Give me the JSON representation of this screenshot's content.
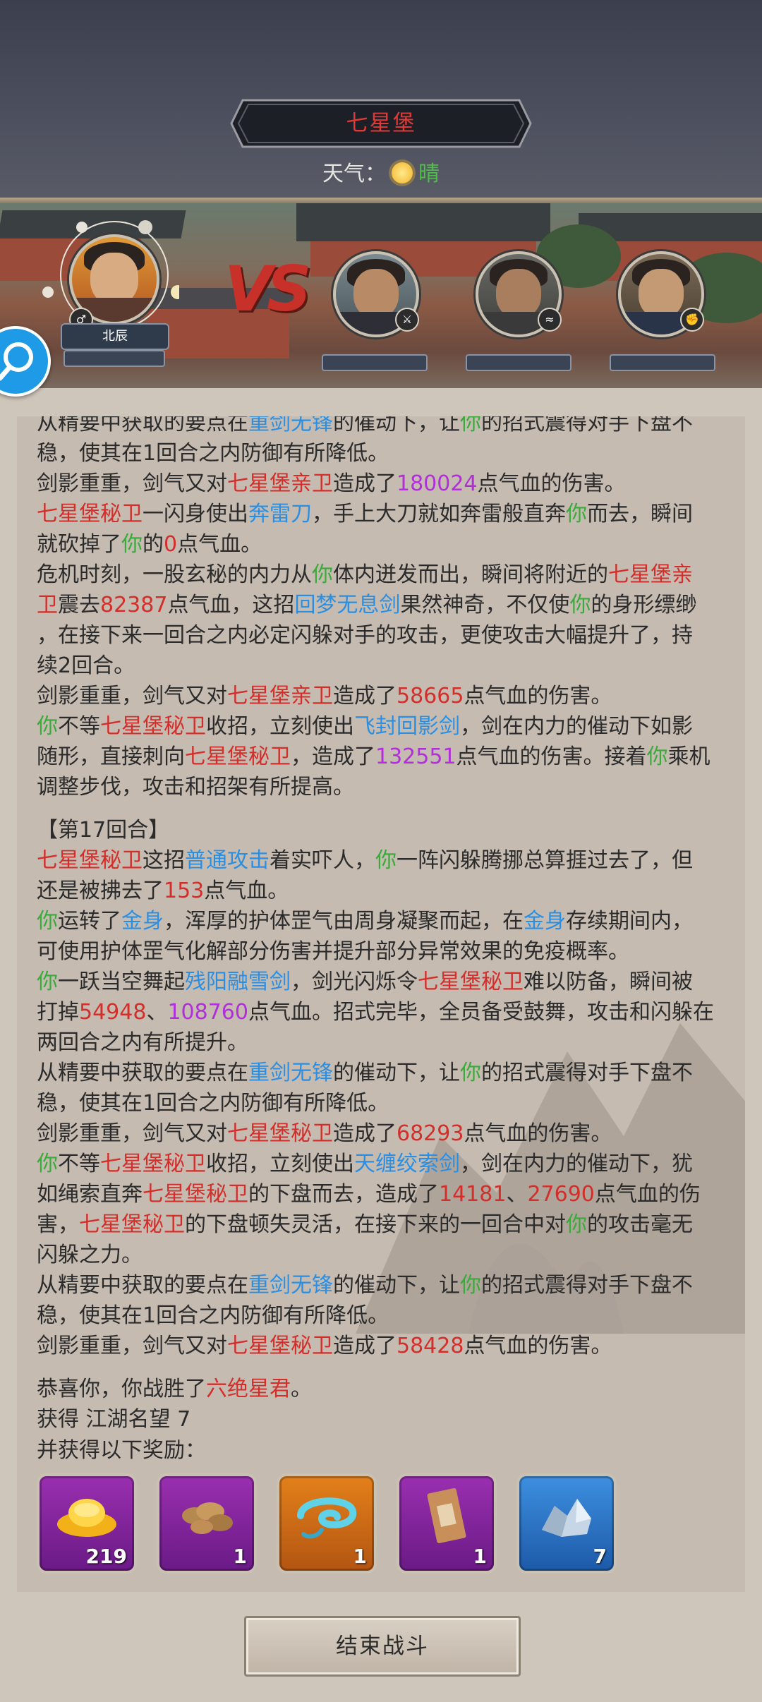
{
  "header": {
    "location": "七星堡",
    "weather_label": "天气：",
    "weather_condition": "晴"
  },
  "battle": {
    "player_name": "北辰",
    "vs_icon": "vs-emblem",
    "enemies": [
      {
        "badge_icon": "sword-icon"
      },
      {
        "badge_icon": "wind-icon"
      },
      {
        "badge_icon": "fist-icon"
      }
    ]
  },
  "log": {
    "lines": [
      {
        "parts": [
          [
            "",
            "从精要中获取的要点在"
          ],
          [
            "b",
            "重剑无锋"
          ],
          [
            "",
            "的催动下，让"
          ],
          [
            "g",
            "你"
          ],
          [
            "",
            "的招式震得对手下盘不"
          ]
        ]
      },
      {
        "parts": [
          [
            "",
            "稳，使其在1回合之内防御有所降低。"
          ]
        ]
      },
      {
        "parts": [
          [
            "",
            "剑影重重，剑气又对"
          ],
          [
            "r",
            "七星堡亲卫"
          ],
          [
            "",
            "造成了"
          ],
          [
            "p",
            "180024"
          ],
          [
            "",
            "点气血的伤害。"
          ]
        ]
      },
      {
        "parts": [
          [
            "r",
            "七星堡秘卫"
          ],
          [
            "",
            "一闪身使出"
          ],
          [
            "b",
            "奔雷刀"
          ],
          [
            "",
            "，手上大刀就如奔雷般直奔"
          ],
          [
            "g",
            "你"
          ],
          [
            "",
            "而去，瞬间"
          ]
        ]
      },
      {
        "parts": [
          [
            "",
            "就砍掉了"
          ],
          [
            "g",
            "你"
          ],
          [
            "",
            "的"
          ],
          [
            "r",
            "0"
          ],
          [
            "",
            "点气血。"
          ]
        ]
      },
      {
        "parts": [
          [
            "",
            "危机时刻，一股玄秘的内力从"
          ],
          [
            "g",
            "你"
          ],
          [
            "",
            "体内迸发而出，瞬间将附近的"
          ],
          [
            "r",
            "七星堡亲"
          ]
        ]
      },
      {
        "parts": [
          [
            "r",
            "卫"
          ],
          [
            "",
            "震去"
          ],
          [
            "r",
            "82387"
          ],
          [
            "",
            "点气血，这招"
          ],
          [
            "b",
            "回梦无息剑"
          ],
          [
            "",
            "果然神奇，不仅使"
          ],
          [
            "g",
            "你"
          ],
          [
            "",
            "的身形缥缈"
          ]
        ]
      },
      {
        "parts": [
          [
            "",
            "，在接下来一回合之内必定闪躲对手的攻击，更使攻击大幅提升了，持"
          ]
        ]
      },
      {
        "parts": [
          [
            "",
            "续2回合。"
          ]
        ]
      },
      {
        "parts": [
          [
            "",
            "剑影重重，剑气又对"
          ],
          [
            "r",
            "七星堡亲卫"
          ],
          [
            "",
            "造成了"
          ],
          [
            "r",
            "58665"
          ],
          [
            "",
            "点气血的伤害。"
          ]
        ]
      },
      {
        "parts": [
          [
            "g",
            "你"
          ],
          [
            "",
            "不等"
          ],
          [
            "r",
            "七星堡秘卫"
          ],
          [
            "",
            "收招，立刻使出"
          ],
          [
            "b",
            "飞封回影剑"
          ],
          [
            "",
            "，剑在内力的催动下如影"
          ]
        ]
      },
      {
        "parts": [
          [
            "",
            "随形，直接刺向"
          ],
          [
            "r",
            "七星堡秘卫"
          ],
          [
            "",
            "，造成了"
          ],
          [
            "p",
            "132551"
          ],
          [
            "",
            "点气血的伤害。接着"
          ],
          [
            "g",
            "你"
          ],
          [
            "",
            "乘机"
          ]
        ]
      },
      {
        "parts": [
          [
            "",
            "调整步伐，攻击和招架有所提高。"
          ]
        ]
      },
      {
        "gap": true
      },
      {
        "parts": [
          [
            "",
            "【第17回合】"
          ]
        ]
      },
      {
        "parts": [
          [
            "r",
            "七星堡秘卫"
          ],
          [
            "",
            "这招"
          ],
          [
            "b",
            "普通攻击"
          ],
          [
            "",
            "着实吓人，"
          ],
          [
            "g",
            "你"
          ],
          [
            "",
            "一阵闪躲腾挪总算捱过去了，但"
          ]
        ]
      },
      {
        "parts": [
          [
            "",
            "还是被拂去了"
          ],
          [
            "r",
            "153"
          ],
          [
            "",
            "点气血。"
          ]
        ]
      },
      {
        "parts": [
          [
            "g",
            "你"
          ],
          [
            "",
            "运转了"
          ],
          [
            "b",
            "金身"
          ],
          [
            "",
            "，浑厚的护体罡气由周身凝聚而起，在"
          ],
          [
            "b",
            "金身"
          ],
          [
            "",
            "存续期间内，"
          ]
        ]
      },
      {
        "parts": [
          [
            "",
            "可使用护体罡气化解部分伤害并提升部分异常效果的免疫概率。"
          ]
        ]
      },
      {
        "parts": [
          [
            "g",
            "你"
          ],
          [
            "",
            "一跃当空舞起"
          ],
          [
            "b",
            "残阳融雪剑"
          ],
          [
            "",
            "，剑光闪烁令"
          ],
          [
            "r",
            "七星堡秘卫"
          ],
          [
            "",
            "难以防备，瞬间被"
          ]
        ]
      },
      {
        "parts": [
          [
            "",
            "打掉"
          ],
          [
            "r",
            "54948"
          ],
          [
            "",
            "、"
          ],
          [
            "p",
            "108760"
          ],
          [
            "",
            "点气血。招式完毕，全员备受鼓舞，攻击和闪躲在"
          ]
        ]
      },
      {
        "parts": [
          [
            "",
            "两回合之内有所提升。"
          ]
        ]
      },
      {
        "parts": [
          [
            "",
            "从精要中获取的要点在"
          ],
          [
            "b",
            "重剑无锋"
          ],
          [
            "",
            "的催动下，让"
          ],
          [
            "g",
            "你"
          ],
          [
            "",
            "的招式震得对手下盘不"
          ]
        ]
      },
      {
        "parts": [
          [
            "",
            "稳，使其在1回合之内防御有所降低。"
          ]
        ]
      },
      {
        "parts": [
          [
            "",
            "剑影重重，剑气又对"
          ],
          [
            "r",
            "七星堡秘卫"
          ],
          [
            "",
            "造成了"
          ],
          [
            "r",
            "68293"
          ],
          [
            "",
            "点气血的伤害。"
          ]
        ]
      },
      {
        "parts": [
          [
            "g",
            "你"
          ],
          [
            "",
            "不等"
          ],
          [
            "r",
            "七星堡秘卫"
          ],
          [
            "",
            "收招，立刻使出"
          ],
          [
            "b",
            "天缠绞索剑"
          ],
          [
            "",
            "，剑在内力的催动下，犹"
          ]
        ]
      },
      {
        "parts": [
          [
            "",
            "如绳索直奔"
          ],
          [
            "r",
            "七星堡秘卫"
          ],
          [
            "",
            "的下盘而去，造成了"
          ],
          [
            "r",
            "14181"
          ],
          [
            "",
            "、"
          ],
          [
            "r",
            "27690"
          ],
          [
            "",
            "点气血的伤"
          ]
        ]
      },
      {
        "parts": [
          [
            "",
            "害，"
          ],
          [
            "r",
            "七星堡秘卫"
          ],
          [
            "",
            "的下盘顿失灵活，在接下来的一回合中对"
          ],
          [
            "g",
            "你"
          ],
          [
            "",
            "的攻击毫无"
          ]
        ]
      },
      {
        "parts": [
          [
            "",
            "闪躲之力。"
          ]
        ]
      },
      {
        "parts": [
          [
            "",
            "从精要中获取的要点在"
          ],
          [
            "b",
            "重剑无锋"
          ],
          [
            "",
            "的催动下，让"
          ],
          [
            "g",
            "你"
          ],
          [
            "",
            "的招式震得对手下盘不"
          ]
        ]
      },
      {
        "parts": [
          [
            "",
            "稳，使其在1回合之内防御有所降低。"
          ]
        ]
      },
      {
        "parts": [
          [
            "",
            "剑影重重，剑气又对"
          ],
          [
            "r",
            "七星堡秘卫"
          ],
          [
            "",
            "造成了"
          ],
          [
            "r",
            "58428"
          ],
          [
            "",
            "点气血的伤害。"
          ]
        ]
      },
      {
        "gap": true
      },
      {
        "parts": [
          [
            "",
            "恭喜你，你战胜了"
          ],
          [
            "r",
            "六绝星君"
          ],
          [
            "",
            "。"
          ]
        ]
      }
    ]
  },
  "rewards": {
    "gain_text": "获得  江湖名望 7",
    "also_text": "并获得以下奖励：",
    "items": [
      {
        "icon": "gold-ingot-icon",
        "qty": "219",
        "rarity": "purple"
      },
      {
        "icon": "herb-root-icon",
        "qty": "1",
        "rarity": "purple"
      },
      {
        "icon": "blue-whirlwind-icon",
        "qty": "1",
        "rarity": "orange"
      },
      {
        "icon": "secret-letter-icon",
        "qty": "1",
        "rarity": "purple"
      },
      {
        "icon": "crystal-ore-icon",
        "qty": "7",
        "rarity": "blue"
      }
    ]
  },
  "buttons": {
    "end_battle": "结束战斗"
  },
  "colors": {
    "enemy_red": "#d42e2a",
    "skill_blue": "#2a8fe3",
    "self_green": "#3aaa3a",
    "crit_purple": "#b02fd8"
  }
}
